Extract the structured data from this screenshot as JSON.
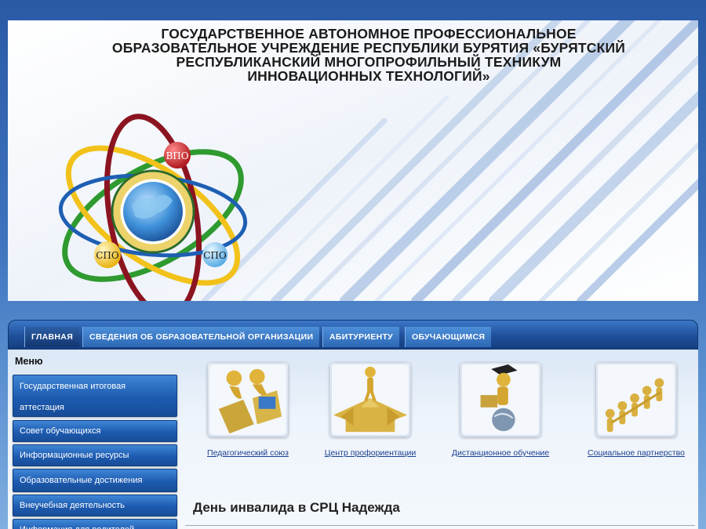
{
  "header": {
    "title_lines": [
      "ГОСУДАРСТВЕННОЕ АВТОНОМНОЕ ПРОФЕССИОНАЛЬНОЕ",
      "ОБРАЗОВАТЕЛЬНОЕ УЧРЕЖДЕНИЕ РЕСПУБЛИКИ БУРЯТИЯ «БУРЯТСКИЙ",
      "РЕСПУБЛИКАНСКИЙ МНОГОПРОФИЛЬНЫЙ ТЕХНИКУМ",
      "ИННОВАЦИОННЫХ ТЕХНОЛОГИЙ»"
    ],
    "emblem": {
      "badges": [
        "ВПО",
        "СПО",
        "СПО"
      ]
    }
  },
  "nav": {
    "items": [
      {
        "label": "ГЛАВНАЯ",
        "active": true
      },
      {
        "label": "СВЕДЕНИЯ ОБ ОБРАЗОВАТЕЛЬНОЙ ОРГАНИЗАЦИИ",
        "active": false
      },
      {
        "label": "АБИТУРИЕНТУ",
        "active": false
      },
      {
        "label": "ОБУЧАЮЩИМСЯ",
        "active": false
      }
    ]
  },
  "sidebar": {
    "title": "Меню",
    "items": [
      {
        "line1": "Государственная итоговая",
        "line2": "аттестация"
      },
      {
        "line1": "Совет обучающихся"
      },
      {
        "line1": "Информационные ресурсы"
      },
      {
        "line1": "Образовательные достижения"
      },
      {
        "line1": "Внеучебная деятельность"
      },
      {
        "line1": "Информация для родителей"
      }
    ]
  },
  "tiles": [
    {
      "label": "Педагогический союз",
      "icon": "teamwork-laptop-icon"
    },
    {
      "label": "Центр профориентации",
      "icon": "crossroads-arrows-icon"
    },
    {
      "label": "Дистанционное обучение",
      "icon": "graduate-globe-icon"
    },
    {
      "label": "Социальное партнерство",
      "icon": "people-chain-icon"
    }
  ],
  "news": {
    "title": "День инвалида в СРЦ Надежда"
  },
  "colors": {
    "nav_dark": "#163f80",
    "nav_light": "#3c78c8",
    "link": "#1b3f8f",
    "badge_red": "#c8282c",
    "badge_blue": "#7cc4f0",
    "badge_yellow": "#f3c020"
  }
}
